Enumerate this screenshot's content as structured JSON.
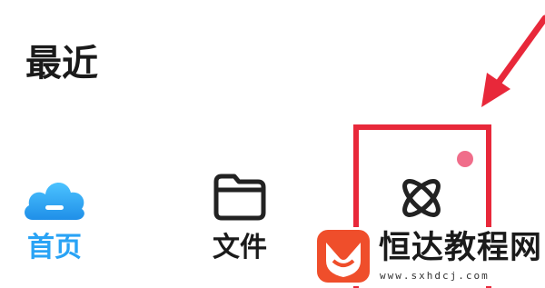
{
  "section": {
    "title": "最近"
  },
  "tabs": [
    {
      "label": "首页",
      "icon": "cloud-home-icon",
      "active": true,
      "color": "#29a3f5"
    },
    {
      "label": "文件",
      "icon": "folder-icon",
      "active": false,
      "color": "#1a1a1a"
    },
    {
      "label": "",
      "icon": "atom-discover-icon",
      "active": false,
      "has_badge": true
    }
  ],
  "annotation": {
    "box_color": "#e8283a",
    "arrow_color": "#e8283a"
  },
  "watermark": {
    "brand": "恒达教程网",
    "url": "www.sxhdcj.com",
    "logo_color": "#ef4e2b"
  }
}
